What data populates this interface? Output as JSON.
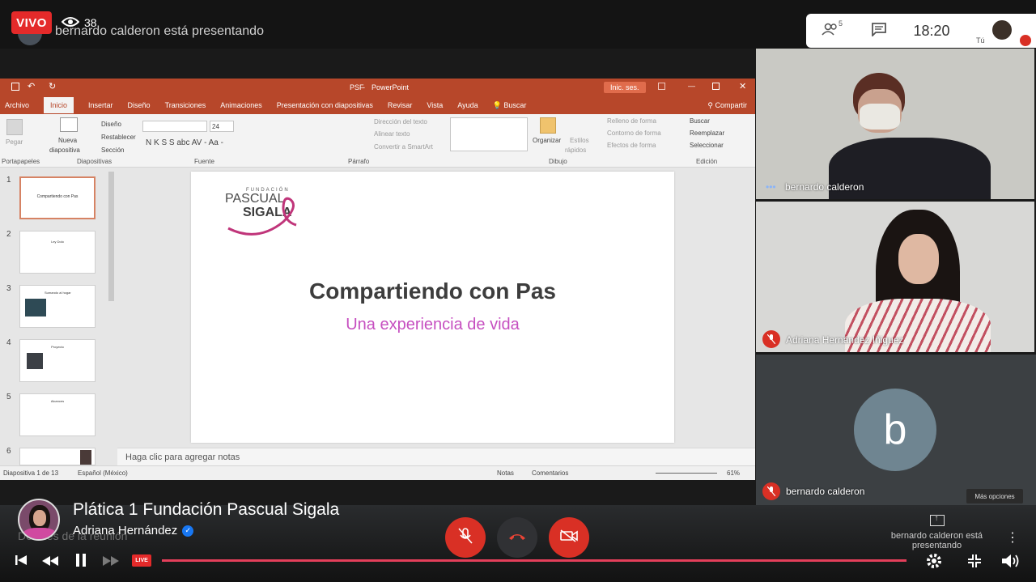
{
  "top": {
    "live_label": "VIVO",
    "viewer_count": "38",
    "presenting_text": "bernardo calderon está presentando",
    "participants_count": "5",
    "time": "18:20",
    "you_label": "Tú"
  },
  "ppt": {
    "filename": "PSF",
    "app": "PowerPoint",
    "signin": "Inic. ses.",
    "tabs": [
      "Archivo",
      "Inicio",
      "Insertar",
      "Diseño",
      "Transiciones",
      "Animaciones",
      "Presentación con diapositivas",
      "Revisar",
      "Vista",
      "Ayuda",
      "Buscar"
    ],
    "share": "Compartir",
    "ribbon": {
      "pegar": "Pegar",
      "nueva": "Nueva",
      "diapositiva": "diapositiva",
      "diseno": "Diseño",
      "restablecer": "Restablecer",
      "seccion": "Sección",
      "font_size": "24",
      "font_format": "N K S S abc AV - Aa -",
      "direccion": "Dirección del texto",
      "alinear": "Alinear texto",
      "smartart": "Convertir a SmartArt",
      "organizar": "Organizar",
      "estilos": "Estilos",
      "rapidos": "rápidos",
      "relleno": "Relleno de forma",
      "contorno": "Contorno de forma",
      "efectos": "Efectos de forma",
      "buscar": "Buscar",
      "reemplazar": "Reemplazar",
      "seleccionar": "Seleccionar"
    },
    "groups": [
      "Portapapeles",
      "Diapositivas",
      "Fuente",
      "Párrafo",
      "Dibujo",
      "Edición"
    ],
    "thumbs": [
      {
        "num": "1",
        "title": "Compartiendo con Pas"
      },
      {
        "num": "2",
        "title": "Ley Dolo"
      },
      {
        "num": "3",
        "title": "Sumando al hogar"
      },
      {
        "num": "4",
        "title": "Proyecto"
      },
      {
        "num": "5",
        "title": "Alcances"
      },
      {
        "num": "6",
        "title": ""
      }
    ],
    "slide": {
      "logo_top": "FUNDACIÓN",
      "logo_line1": "PASCUAL",
      "logo_line2": "SIGALA",
      "title": "Compartiendo con Pas",
      "subtitle": "Una experiencia de vida"
    },
    "notes_placeholder": "Haga clic para agregar notas",
    "status": {
      "slide_of": "Diapositiva 1 de 13",
      "language": "Español (México)",
      "notes": "Notas",
      "comments": "Comentarios",
      "zoom": "61%"
    }
  },
  "participants": [
    {
      "name": "bernardo calderon"
    },
    {
      "name": "Adriana Hernández Iñiguez"
    },
    {
      "name": "bernardo calderon",
      "initial": "b"
    }
  ],
  "more_options": "Más opciones",
  "stream": {
    "title": "Plática 1 Fundación Pascual Sigala",
    "author": "Adriana Hernández",
    "meeting_details": "Detalles de la reunión",
    "present_label": "bernardo calderon está presentando",
    "live_chip": "LIVE"
  },
  "colors": {
    "ppt_red": "#b7472a",
    "meet_red": "#d93025",
    "live_red": "#e42a2a",
    "slide_subtitle": "#c64fc0"
  }
}
